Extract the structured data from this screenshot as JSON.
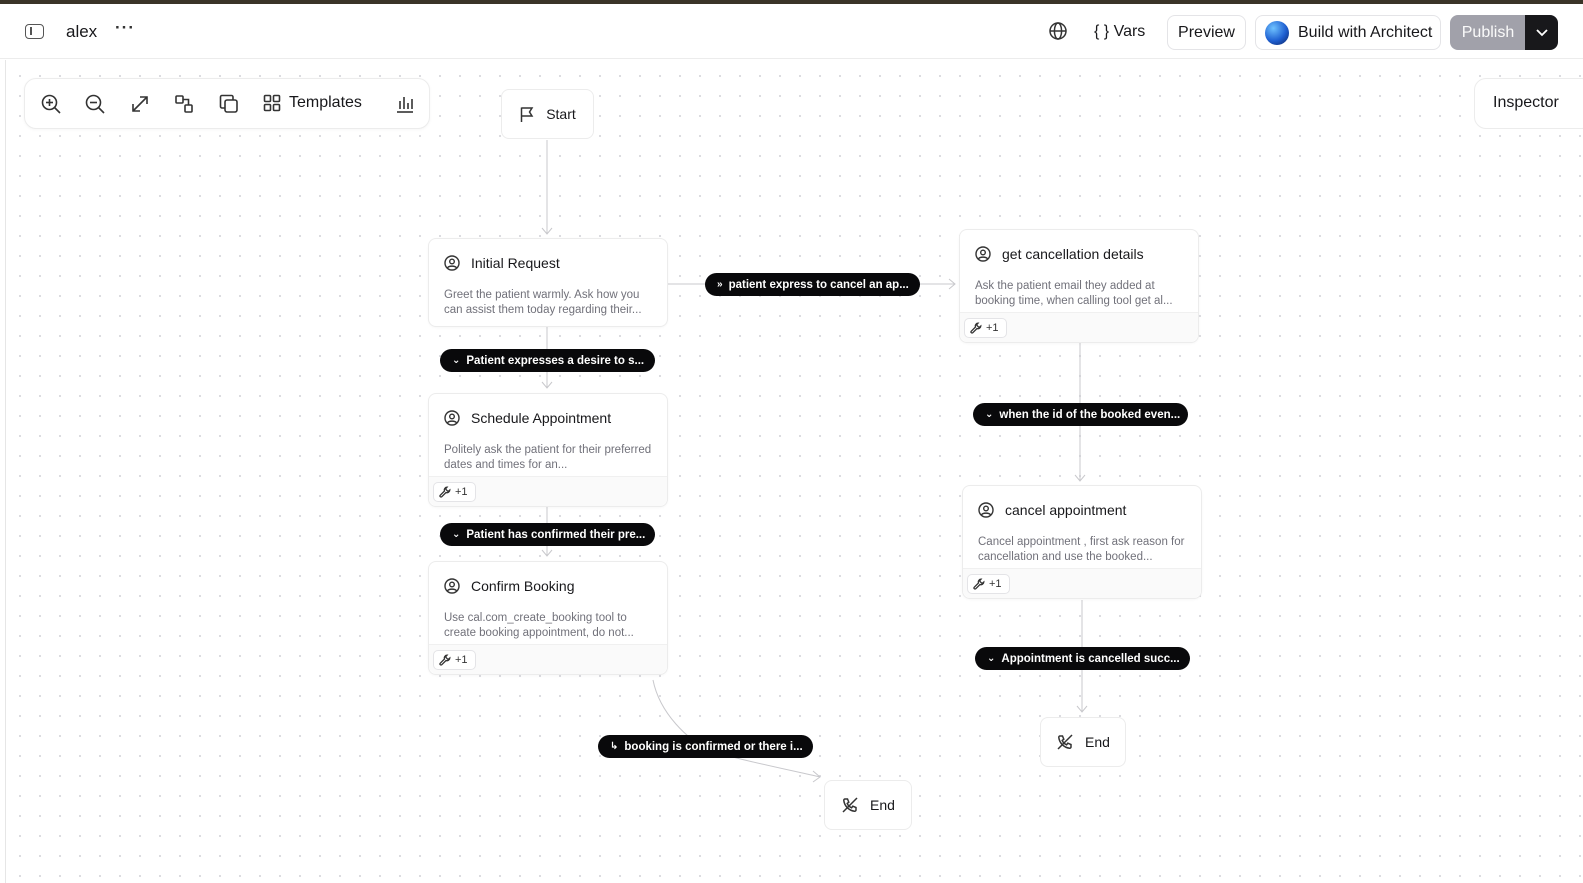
{
  "header": {
    "project_name": "alex",
    "more_label": "···",
    "vars_label": "{ } Vars",
    "preview_label": "Preview",
    "architect_label": "Build with Architect",
    "publish_label": "Publish"
  },
  "toolbar": {
    "templates_label": "Templates",
    "icons": [
      "zoom-in-icon",
      "zoom-out-icon",
      "fit-view-icon",
      "auto-layout-icon",
      "duplicate-icon",
      "templates-grid-icon",
      "analytics-icon"
    ]
  },
  "inspector": {
    "label": "Inspector"
  },
  "nodes": {
    "start": {
      "label": "Start"
    },
    "initial_request": {
      "title": "Initial Request",
      "description": "Greet the patient warmly. Ask how you can assist them today regarding their..."
    },
    "schedule_appointment": {
      "title": "Schedule Appointment",
      "description": "Politely ask the patient for their preferred dates and times for an...",
      "tools": "+1"
    },
    "confirm_booking": {
      "title": "Confirm Booking",
      "description": "Use cal.com_create_booking tool to create booking appointment, do not...",
      "tools": "+1"
    },
    "get_cancellation_details": {
      "title": "get cancellation details",
      "description": "Ask the patient email they added at booking time, when calling tool get al...",
      "tools": "+1"
    },
    "cancel_appointment": {
      "title": "cancel appointment",
      "description": "Cancel appointment , first ask reason for cancellation and use the booked...",
      "tools": "+1"
    },
    "end_booking": {
      "label": "End"
    },
    "end_cancel": {
      "label": "End"
    }
  },
  "edges": {
    "cancel_intent": "patient express to cancel an ap...",
    "schedule_intent": "Patient expresses a desire to s...",
    "confirmed_pref": "Patient has confirmed their pre...",
    "booking_done": "booking is confirmed or there i...",
    "booked_id": "when the id of the booked even...",
    "cancelled_ok": "Appointment is cancelled succ..."
  }
}
